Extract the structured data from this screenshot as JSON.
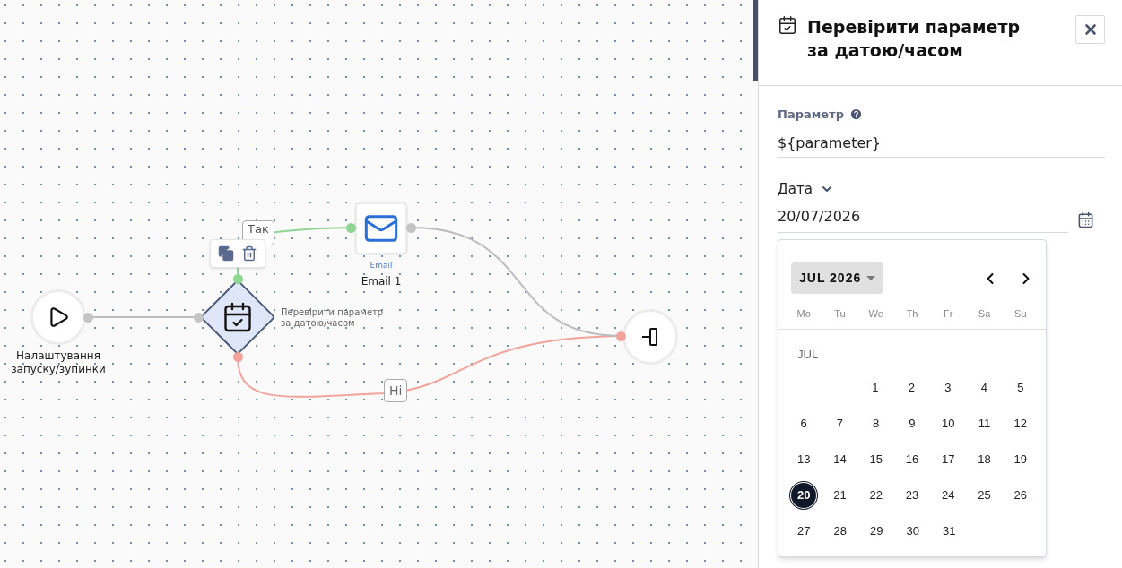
{
  "canvas": {
    "start_node": {
      "label": "Налаштування запуску/зупинки"
    },
    "condition_node": {
      "label": "Перевірити параметр за датою/часом",
      "selected": true
    },
    "email_node": {
      "type": "Email",
      "label": "Email 1"
    },
    "edges": [
      {
        "kind": "yes",
        "label": "Так",
        "color": "#8fd694"
      },
      {
        "kind": "no",
        "label": "Ні",
        "color": "#f2a39c"
      },
      {
        "kind": "plain",
        "color": "#bdbdbd"
      }
    ]
  },
  "panel": {
    "title": "Перевірити параметр за датою/часом",
    "fields": [
      {
        "kind": "text",
        "label": "Параметр",
        "value": "${parameter}"
      },
      {
        "kind": "date",
        "label": "Дата",
        "value": "20/07/2026"
      }
    ],
    "calendar": {
      "month_button": "JUL 2026",
      "weekdays": [
        "Mo",
        "Tu",
        "We",
        "Th",
        "Fr",
        "Sa",
        "Su"
      ],
      "month_heading": "JUL",
      "weeks": [
        {
          "kind": "leading",
          "days": [
            {
              "label": "1",
              "selected": false
            },
            {
              "label": "2",
              "selected": false
            },
            {
              "label": "3",
              "selected": false
            },
            {
              "label": "4",
              "selected": false
            },
            {
              "label": "5",
              "selected": false
            }
          ]
        },
        {
          "kind": "full",
          "days": [
            {
              "label": "6",
              "selected": false
            },
            {
              "label": "7",
              "selected": false
            },
            {
              "label": "8",
              "selected": false
            },
            {
              "label": "9",
              "selected": false
            },
            {
              "label": "10",
              "selected": false
            },
            {
              "label": "11",
              "selected": false
            },
            {
              "label": "12",
              "selected": false
            }
          ]
        },
        {
          "kind": "full",
          "days": [
            {
              "label": "13",
              "selected": false
            },
            {
              "label": "14",
              "selected": false
            },
            {
              "label": "15",
              "selected": false
            },
            {
              "label": "16",
              "selected": false
            },
            {
              "label": "17",
              "selected": false
            },
            {
              "label": "18",
              "selected": false
            },
            {
              "label": "19",
              "selected": false
            }
          ]
        },
        {
          "kind": "full",
          "days": [
            {
              "label": "20",
              "selected": true
            },
            {
              "label": "21",
              "selected": false
            },
            {
              "label": "22",
              "selected": false
            },
            {
              "label": "23",
              "selected": false
            },
            {
              "label": "24",
              "selected": false
            },
            {
              "label": "25",
              "selected": false
            },
            {
              "label": "26",
              "selected": false
            }
          ]
        },
        {
          "kind": "trailing",
          "days": [
            {
              "label": "27",
              "selected": false
            },
            {
              "label": "28",
              "selected": false
            },
            {
              "label": "29",
              "selected": false
            },
            {
              "label": "30",
              "selected": false
            },
            {
              "label": "31",
              "selected": false
            }
          ]
        }
      ]
    }
  }
}
